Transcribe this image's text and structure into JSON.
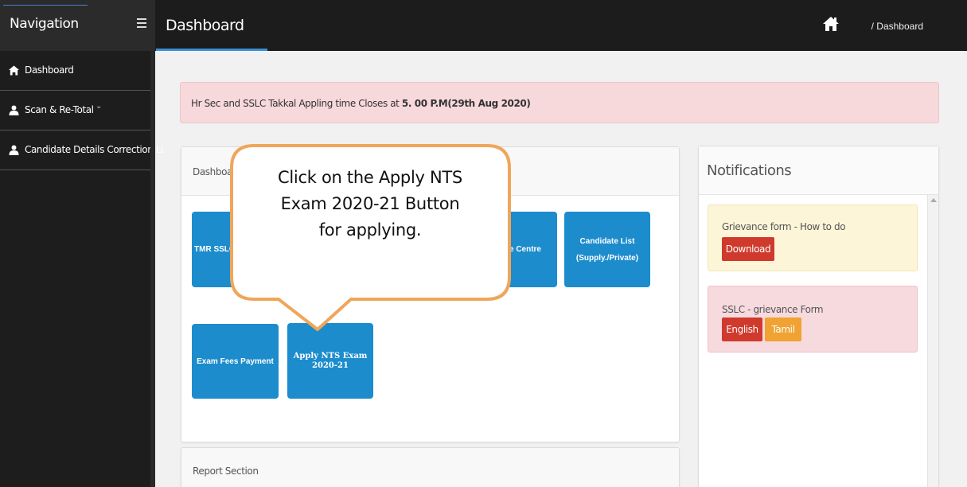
{
  "nav": {
    "title": "Navigation"
  },
  "header": {
    "title": "Dashboard",
    "breadcrumb": "/ Dashboard"
  },
  "sidebar": {
    "items": [
      {
        "label": "Dashboard",
        "icon": "home-icon"
      },
      {
        "label": "Scan & Re-Total",
        "icon": "user-icon",
        "has_submenu": true
      },
      {
        "label": "Candidate Details Correction Li",
        "icon": "user-icon"
      }
    ]
  },
  "alert": {
    "text": "Hr Sec and SSLC Takkal Appling time Closes at ",
    "bold": "5. 00 P.M(29th Aug 2020)"
  },
  "dashboard_panel": {
    "header": "Dashboar",
    "tiles": [
      {
        "label": "TMR SSLC"
      },
      {
        "label": "late Centre"
      },
      {
        "label": "Candidate List",
        "sublabel": "(Supply./Private)"
      },
      {
        "label": "Exam Fees Payment"
      },
      {
        "label": "Apply NTS Exam",
        "sublabel": "2020-21"
      }
    ]
  },
  "report_panel": {
    "header": "Report Section"
  },
  "notifications": {
    "title": "Notifications",
    "items": [
      {
        "title": "Grievance form - How to do",
        "buttons": [
          "Download"
        ]
      },
      {
        "title": "SSLC - grievance Form",
        "buttons": [
          "English",
          "Tamil"
        ]
      }
    ]
  },
  "callout": {
    "line1": "Click on the Apply NTS",
    "line2": "Exam 2020-21 Button",
    "line3": "for applying."
  },
  "colors": {
    "tile_blue": "#1c8ccd",
    "callout_border": "#f0a65a",
    "button_red": "#cf3a2d",
    "button_orange": "#f0a232"
  }
}
